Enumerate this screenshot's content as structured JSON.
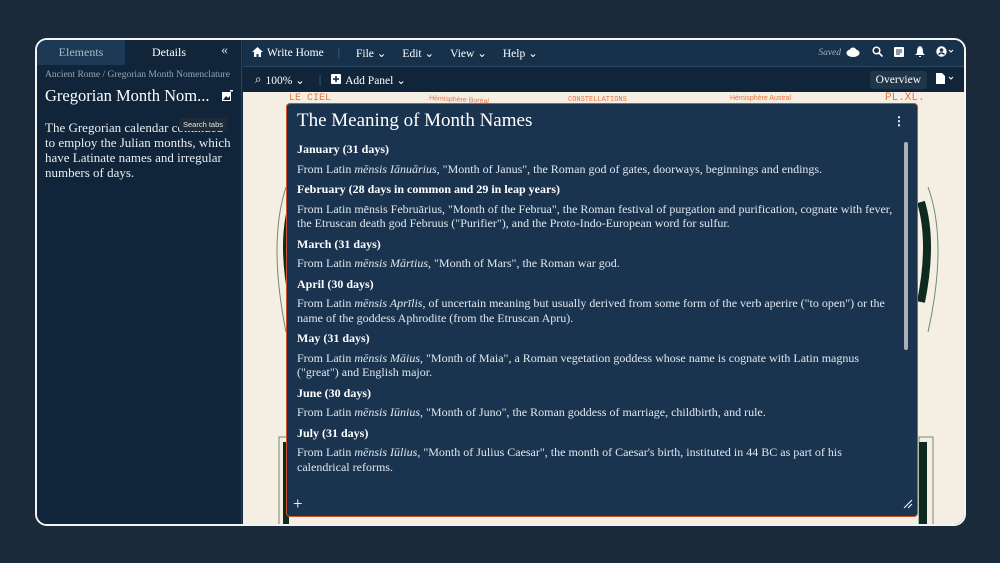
{
  "sidebar": {
    "tabs": [
      "Elements",
      "Details"
    ],
    "collapse": "«",
    "breadcrumb": "Ancient Rome / Gregorian Month Nomenclature",
    "title": "Gregorian Month Nom...",
    "tooltip": "Search tabs",
    "description": "The Gregorian calendar continued to employ the Julian months, which have Latinate names and irregular numbers of days."
  },
  "topbar": {
    "home": "Write Home",
    "menus": [
      "File",
      "Edit",
      "View",
      "Help"
    ],
    "status": "Saved"
  },
  "toolbar": {
    "zoom": "100%",
    "add_panel": "Add Panel",
    "overview": "Overview"
  },
  "canvas": {
    "labels": [
      "LE CIEL",
      "Hémisphère Boréal",
      "CONSTELLATIONS",
      "Hémisphère Austral",
      "PL.XL."
    ]
  },
  "panel": {
    "title": "The Meaning of Month Names",
    "months": [
      {
        "heading": "January (31 days)",
        "pre": "From Latin ",
        "latin": "mēnsis Iānuārius",
        "post": ", \"Month of Janus\", the Roman god of gates, doorways, beginnings and endings."
      },
      {
        "heading": "February (28 days in common and 29 in leap years)",
        "pre": "From Latin mēnsis Februārius, \"Month of the Februa\", the Roman festival of purgation and purification, cognate with fever, the Etruscan death god Februus (\"Purifier\"), and the Proto-Indo-European word for sulfur.",
        "latin": "",
        "post": ""
      },
      {
        "heading": "March (31 days)",
        "pre": "From Latin ",
        "latin": "mēnsis Mārtius",
        "post": ", \"Month of Mars\", the Roman war god."
      },
      {
        "heading": "April (30 days)",
        "pre": "From Latin ",
        "latin": "mēnsis Aprīlis",
        "post": ", of uncertain meaning but usually derived from some form of the verb aperire (\"to open\") or the name of the goddess Aphrodite (from the Etruscan Apru)."
      },
      {
        "heading": "May (31 days)",
        "pre": "From Latin ",
        "latin": "mēnsis Māius",
        "post": ", \"Month of Maia\", a Roman vegetation goddess whose name is cognate with Latin magnus (\"great\") and English major."
      },
      {
        "heading": "June (30 days)",
        "pre": "From Latin ",
        "latin": "mēnsis Iūnius",
        "post": ", \"Month of Juno\", the Roman goddess of marriage, childbirth, and rule."
      },
      {
        "heading": "July (31 days)",
        "pre": "From Latin ",
        "latin": "mēnsis Iūlius",
        "post": ", \"Month of Julius Caesar\", the month of Caesar's birth, instituted in 44 BC as part of his calendrical reforms."
      }
    ],
    "add": "+"
  },
  "colors": {
    "accent": "#c9532f",
    "panel": "#1a3450",
    "canvas": "#f5efe3"
  }
}
